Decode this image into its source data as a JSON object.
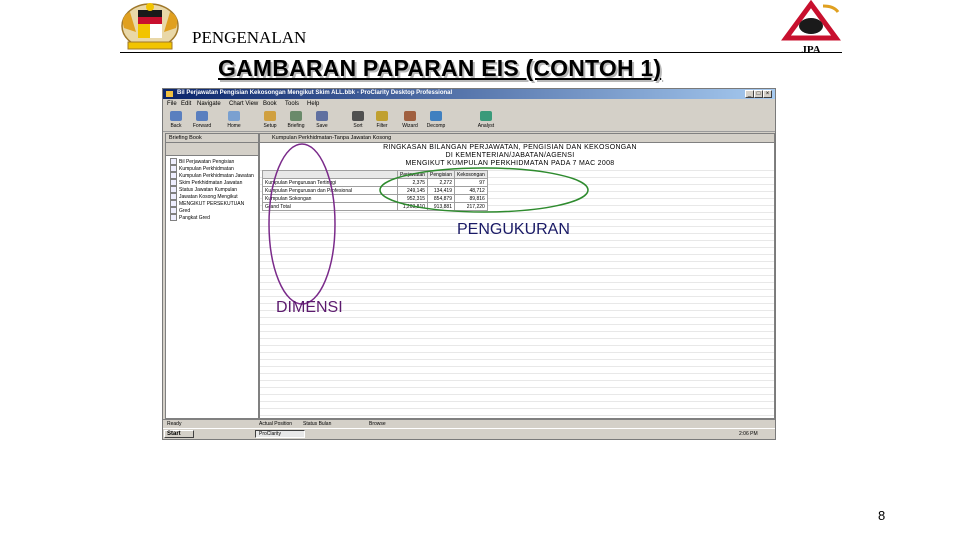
{
  "slide": {
    "section_title": "PENGENALAN",
    "main_title": "GAMBARAN PAPARAN EIS (CONTOH 1)",
    "page_number": "8",
    "logo_right_text": "JPA"
  },
  "screenshot": {
    "window_title": "Bil Perjawatan Pengisian Kekosongan Mengikut Skim ALL.bbk - ProClarity Desktop Professional",
    "menu": [
      "File",
      "Edit",
      "Navigate",
      "Chart View",
      "Book",
      "Tools",
      "Help"
    ],
    "toolbar": [
      "Back",
      "Forward",
      "Home",
      "Setup",
      "Briefing",
      "Save",
      "Sort",
      "Filter",
      "Wizard",
      "Decomp",
      "Analyst"
    ],
    "left_pane": {
      "header": "Briefing Book",
      "items": [
        "Bil Perjawatan Pengisian",
        "Kumpulan Perkhidmatan",
        "Kumpulan Perkhidmatan Jawatan",
        "Skim Perkhidmatan Jawatan",
        "Status Jawatan Kumpulan",
        "Jawatan Kosong Mengikut",
        "MENGIKUT PERSEKUTUAN",
        "Gred",
        "Pangkat Gred"
      ]
    },
    "main_pane": {
      "header": "Kumpulan Perkhidmatan-Tanpa Jawatan Kosong",
      "report_title_lines": [
        "RINGKASAN BILANGAN PERJAWATAN, PENGISIAN DAN KEKOSONGAN",
        "DI KEMENTERIAN/JABATAN/AGENSI",
        "MENGIKUT KUMPULAN PERKHIDMATAN PADA 7 MAC 2008"
      ],
      "columns": [
        "",
        "Perjawatan",
        "Pengisian",
        "Kekosongan"
      ],
      "rows": [
        [
          "Kumpulan Pengurusan Tertinggi",
          "2,375",
          "2,272",
          "97"
        ],
        [
          "Kumpulan Pengurusan dan Profesional",
          "249,145",
          "134,419",
          "48,712"
        ],
        [
          "Kumpulan Sokongan",
          "952,315",
          "854,879",
          "89,816"
        ],
        [
          "Grand Total",
          "1,203,810",
          "913,881",
          "217,220"
        ]
      ]
    },
    "status_bar": [
      "Ready",
      "Actual Position",
      "Status Bulan",
      "Browse"
    ],
    "taskbar": {
      "start": "Start",
      "app": "ProClarity",
      "clock": "2:06 PM"
    }
  },
  "annotations": {
    "measure_label": "PENGUKURAN",
    "dimension_label": "DIMENSI",
    "measure_color": "#2e8b2e",
    "dimension_color": "#7a2a8a"
  }
}
